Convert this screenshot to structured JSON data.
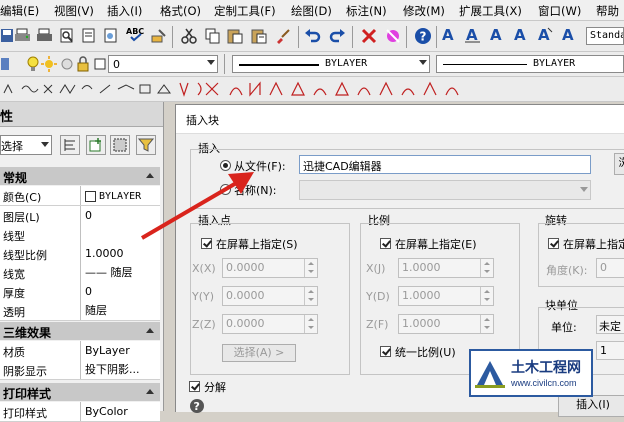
{
  "menu": [
    "编辑(E)",
    "视图(V)",
    "插入(I)",
    "格式(O)",
    "定制工具(F)",
    "绘图(D)",
    "标注(N)",
    "修改(M)",
    "扩展工具(X)",
    "窗口(W)",
    "帮助"
  ],
  "toolbar": {
    "text_style": "Standa",
    "layer_value": "0",
    "color_value": "BYLAYER",
    "linetype_value": "BYLAYER"
  },
  "left_panel": {
    "title_partial": "性",
    "selector_value": "选择",
    "section_general": "常规",
    "general_rows": [
      {
        "key": "颜色(C)",
        "value": "BYLAYER"
      },
      {
        "key": "图层(L)",
        "value": "0"
      },
      {
        "key": "线型",
        "value": ""
      },
      {
        "key": "线型比例",
        "value": "1.0000"
      },
      {
        "key": "线宽",
        "value": "—— 随层"
      },
      {
        "key": "厚度",
        "value": "0"
      },
      {
        "key": "透明",
        "value": "随层"
      }
    ],
    "section_3d": "三维效果",
    "effect_rows": [
      {
        "key": "材质",
        "value": "ByLayer"
      },
      {
        "key": "阴影显示",
        "value": "投下阴影..."
      }
    ],
    "section_print": "打印样式",
    "print_row": {
      "key": "打印样式",
      "value": "ByColor"
    }
  },
  "dialog": {
    "title": "插入块",
    "insert_group": "插入",
    "from_file_label": "从文件(F):",
    "file_value": "迅捷CAD编辑器",
    "name_label": "名称(N):",
    "browse_partial": "浏",
    "insertion_point": {
      "title": "插入点",
      "on_screen": "在屏幕上指定(S)",
      "fields": [
        {
          "label": "X(X)",
          "value": "0.0000"
        },
        {
          "label": "Y(Y)",
          "value": "0.0000"
        },
        {
          "label": "Z(Z)",
          "value": "0.0000"
        }
      ],
      "select_button": "选择(A) >"
    },
    "scale": {
      "title": "比例",
      "on_screen": "在屏幕上指定(E)",
      "fields": [
        {
          "label": "X(J)",
          "value": "1.0000"
        },
        {
          "label": "Y(D)",
          "value": "1.0000"
        },
        {
          "label": "Z(F)",
          "value": "1.0000"
        }
      ],
      "uniform": "统一比例(U)"
    },
    "rotation": {
      "title": "旋转",
      "on_screen": "在屏幕上指定",
      "angle_label": "角度(K):",
      "angle_value": "0"
    },
    "block_unit": {
      "title": "块单位",
      "unit_label": "单位:",
      "unit_value": "未定",
      "scale_value": "1"
    },
    "explode": "分解",
    "insert_button": "插入(I)",
    "help_icon": "?"
  },
  "watermark": {
    "title": "土木工程网",
    "url": "www.civilcn.com"
  },
  "colors": {
    "arrow": "#d9241c",
    "dialog_bg": "#f0f0f0",
    "section_header": "#c8c8c8"
  }
}
